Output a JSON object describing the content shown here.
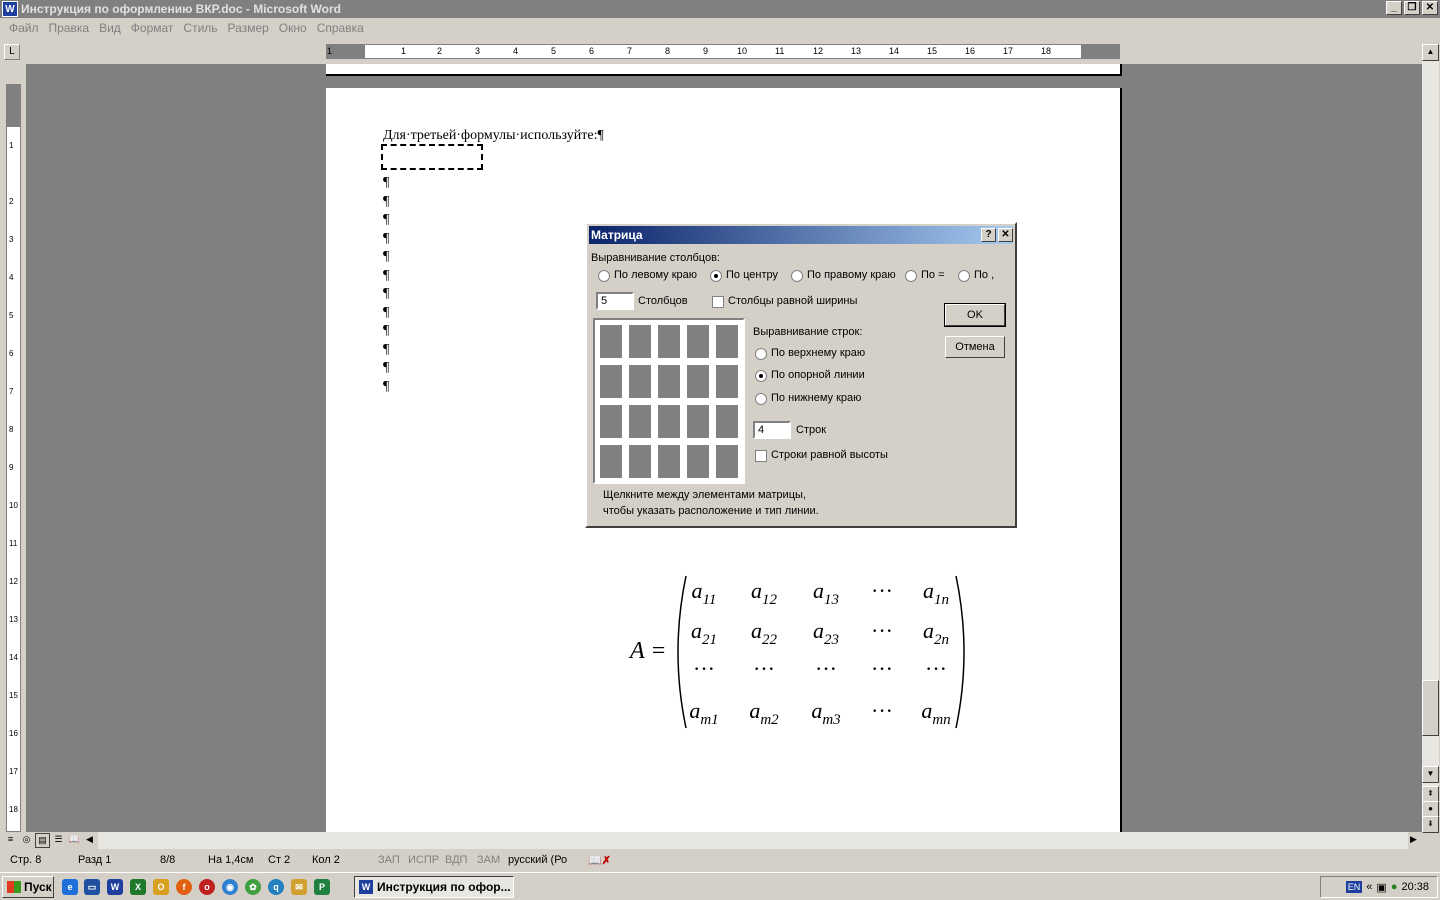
{
  "window": {
    "title": "Инструкция по оформлению ВКР.doc - Microsoft Word",
    "app_icon": "word-icon"
  },
  "menu": [
    "Файл",
    "Правка",
    "Вид",
    "Формат",
    "Стиль",
    "Размер",
    "Окно",
    "Справка"
  ],
  "ruler": {
    "tab_selector": "L",
    "h_numbers": [
      "1",
      "1",
      "2",
      "3",
      "4",
      "5",
      "6",
      "7",
      "8",
      "9",
      "10",
      "11",
      "12",
      "13",
      "14",
      "15",
      "16",
      "17",
      "18"
    ],
    "v_numbers": [
      "1",
      "1",
      "2",
      "3",
      "4",
      "5",
      "6",
      "7",
      "8",
      "9",
      "10",
      "11",
      "12",
      "13",
      "14",
      "15",
      "16",
      "17",
      "18"
    ]
  },
  "document": {
    "line1": "Для·третьей·формулы·используйте:¶",
    "pilcrows": [
      "¶",
      "¶",
      "¶",
      "¶",
      "¶",
      "¶",
      "¶",
      "¶",
      "¶",
      "¶",
      "¶",
      "¶"
    ]
  },
  "dialog": {
    "title": "Матрица",
    "col_align_label": "Выравнивание столбцов:",
    "col_align_options": [
      "По левому краю",
      "По центру",
      "По правому краю",
      "По =",
      "По ,"
    ],
    "col_align_selected": 1,
    "columns_value": "5",
    "columns_label": "Столбцов",
    "equal_cols_label": "Столбцы равной ширины",
    "row_align_label": "Выравнивание строк:",
    "row_align_options": [
      "По верхнему краю",
      "По опорной линии",
      "По нижнему краю"
    ],
    "row_align_selected": 1,
    "rows_value": "4",
    "rows_label": "Строк",
    "equal_rows_label": "Строки равной высоты",
    "ok": "OK",
    "cancel": "Отмена",
    "hint1": "Щелкните между элементами матрицы,",
    "hint2": "чтобы указать расположение и тип линии.",
    "grid_rows": 4,
    "grid_cols": 5
  },
  "formula": {
    "lhs": "A =",
    "rows": [
      [
        "a11",
        "a12",
        "a13",
        "···",
        "a1n"
      ],
      [
        "a21",
        "a22",
        "a23",
        "···",
        "a2n"
      ],
      [
        "···",
        "···",
        "···",
        "···",
        "···"
      ],
      [
        "am1",
        "am2",
        "am3",
        "···",
        "amn"
      ]
    ]
  },
  "status": {
    "page": "Стр. 8",
    "section": "Разд 1",
    "pages": "8/8",
    "at": "На 1,4см",
    "line": "Ст 2",
    "col": "Кол 2",
    "rec": "ЗАП",
    "trk": "ИСПР",
    "ext": "ВДП",
    "ovr": "ЗАМ",
    "lang": "русский (Ро"
  },
  "taskbar": {
    "start": "Пуск",
    "task": "Инструкция по офор...",
    "lang": "EN",
    "clock": "20:38"
  }
}
